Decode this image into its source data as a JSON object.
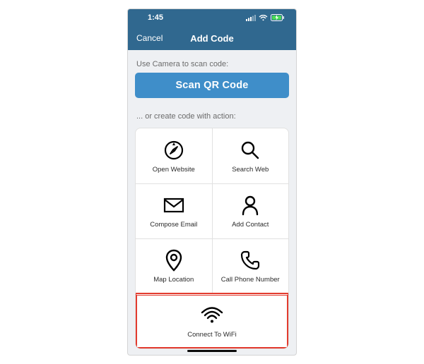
{
  "statusbar": {
    "time": "1:45"
  },
  "navbar": {
    "cancel": "Cancel",
    "title": "Add Code"
  },
  "labels": {
    "scan_section": "Use Camera to scan code:",
    "create_section": "... or create code with action:"
  },
  "buttons": {
    "scan": "Scan QR Code"
  },
  "actions": {
    "open_website": "Open Website",
    "search_web": "Search Web",
    "compose_email": "Compose Email",
    "add_contact": "Add Contact",
    "map_location": "Map Location",
    "call_phone": "Call Phone Number",
    "connect_wifi": "Connect To WiFi"
  }
}
